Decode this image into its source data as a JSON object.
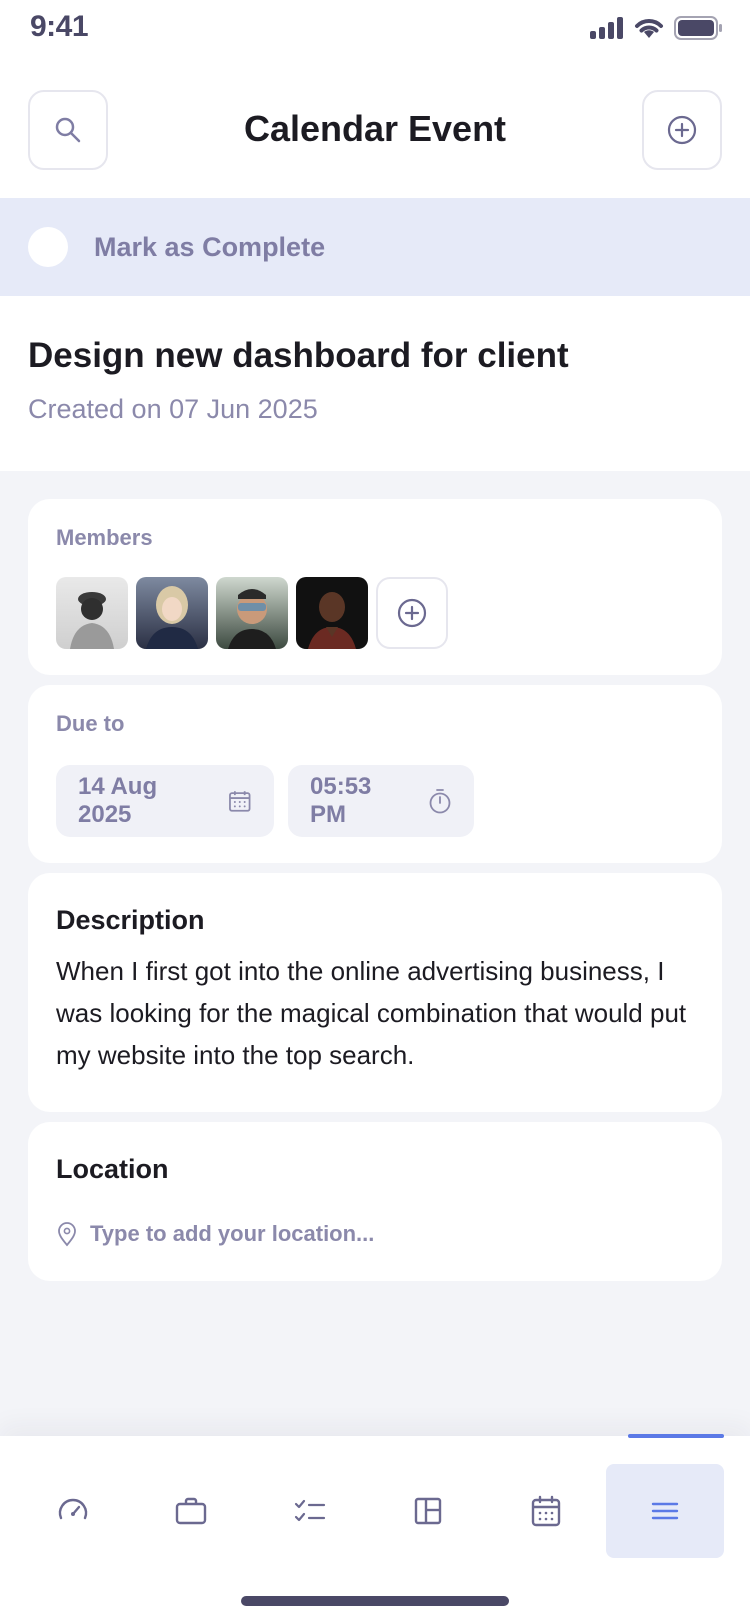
{
  "status_bar": {
    "time": "9:41"
  },
  "header": {
    "title": "Calendar Event",
    "search_icon": "search-icon",
    "add_icon": "plus-circle-icon"
  },
  "complete": {
    "label": "Mark as Complete"
  },
  "task": {
    "title": "Design new dashboard for client",
    "created": "Created on 07 Jun 2025"
  },
  "members": {
    "label": "Members",
    "avatars": [
      "avatar-1",
      "avatar-2",
      "avatar-3",
      "avatar-4"
    ],
    "add_icon": "plus-circle-icon"
  },
  "due": {
    "label": "Due to",
    "date": "14 Aug 2025",
    "time": "05:53 PM",
    "date_icon": "calendar-icon",
    "time_icon": "stopwatch-icon"
  },
  "description": {
    "label": "Description",
    "text": "When I first got into the online advertising business, I was looking for the magical combination that would put my website into the top search."
  },
  "location": {
    "label": "Location",
    "placeholder": "Type to add your location..."
  },
  "tabbar": {
    "items": [
      {
        "icon": "gauge-icon"
      },
      {
        "icon": "briefcase-icon"
      },
      {
        "icon": "checklist-icon"
      },
      {
        "icon": "layout-icon"
      },
      {
        "icon": "calendar-icon"
      },
      {
        "icon": "menu-icon"
      }
    ],
    "active_index": 5
  },
  "colors": {
    "accent": "#5b79e6",
    "highlight": "#e6eaf8",
    "muted_text": "#8b89ab"
  }
}
